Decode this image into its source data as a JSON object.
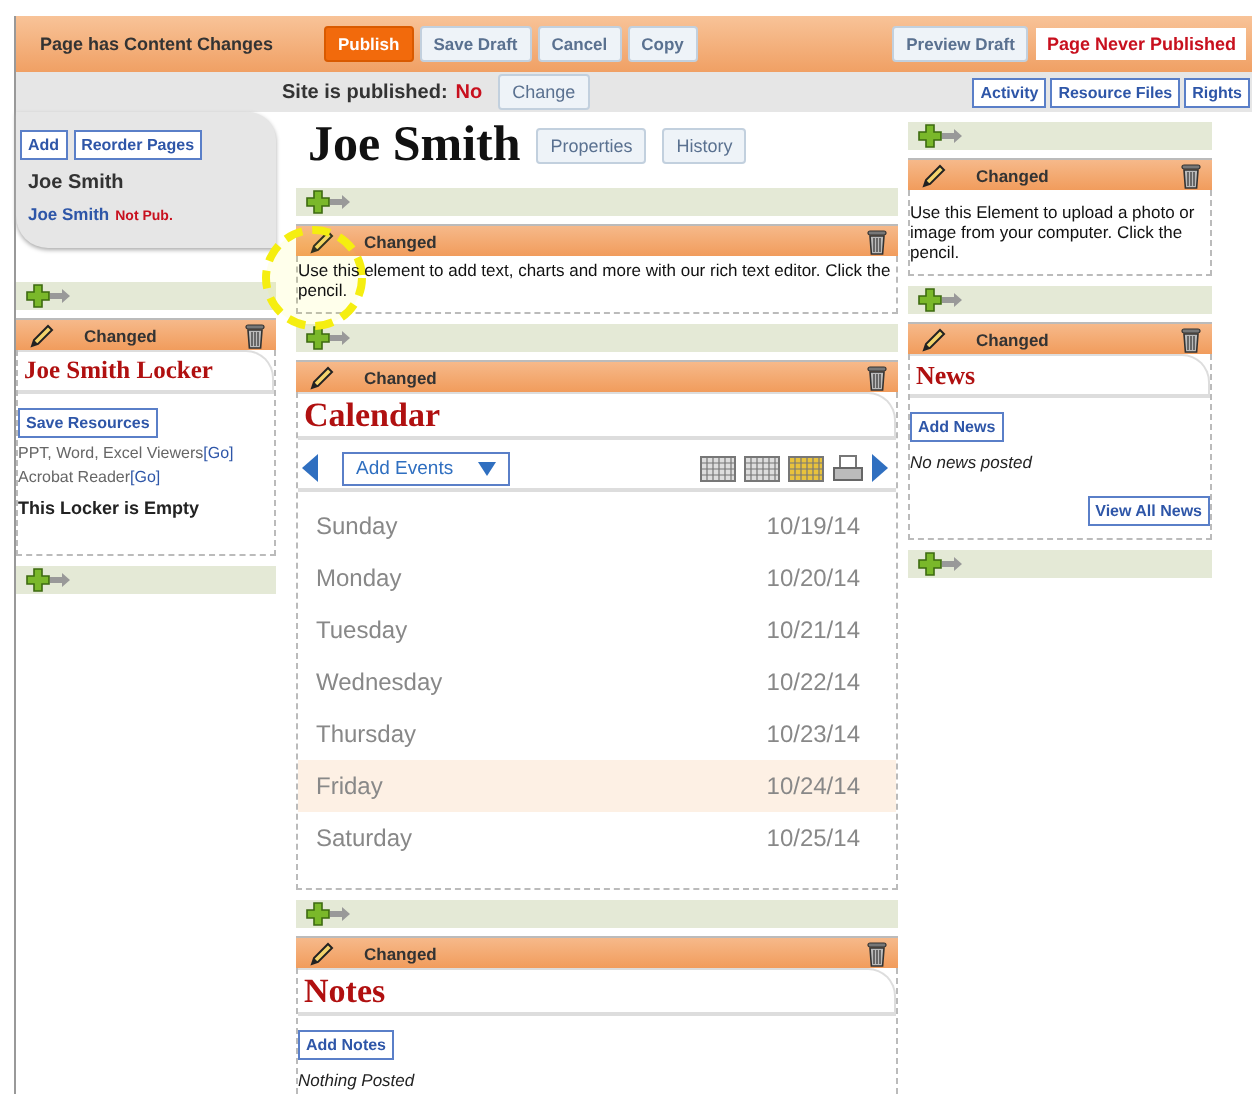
{
  "top_bar": {
    "status": "Page has Content Changes",
    "buttons": [
      {
        "label": "Publish",
        "primary": true
      },
      {
        "label": "Save Draft",
        "primary": false
      },
      {
        "label": "Cancel",
        "primary": false
      },
      {
        "label": "Copy",
        "primary": false
      }
    ],
    "preview_button": "Preview Draft",
    "publish_state": "Page Never Published"
  },
  "sub_bar": {
    "label": "Site is published:",
    "value": "No",
    "change_button": "Change",
    "tabs": [
      "Activity",
      "Resource Files",
      "Rights"
    ]
  },
  "sidebar": {
    "buttons": [
      "Add",
      "Reorder Pages"
    ],
    "heading": "Joe Smith",
    "pages": [
      {
        "name": "Joe Smith",
        "badge": "Not Pub."
      }
    ]
  },
  "page_title": "Joe Smith",
  "title_buttons": [
    "Properties",
    "History"
  ],
  "columns": [
    {
      "elements": [
        {
          "kind": "locker",
          "status": "Changed",
          "title": "Joe Smith Locker",
          "button": "Save Resources",
          "viewers": [
            {
              "text": "PPT, Word, Excel Viewers",
              "link": "[Go]"
            },
            {
              "text": "Acrobat Reader",
              "link": "[Go]"
            }
          ],
          "empty_text": "This Locker is Empty"
        }
      ]
    },
    {
      "elements": [
        {
          "kind": "text",
          "status": "Changed",
          "text": "Use this element to add text, charts and more with our rich text editor. Click the pencil."
        },
        {
          "kind": "calendar",
          "status": "Changed",
          "title": "Calendar",
          "dropdown": "Add Events",
          "days": [
            {
              "day": "Sunday",
              "date": "10/19/14",
              "today": false
            },
            {
              "day": "Monday",
              "date": "10/20/14",
              "today": false
            },
            {
              "day": "Tuesday",
              "date": "10/21/14",
              "today": false
            },
            {
              "day": "Wednesday",
              "date": "10/22/14",
              "today": false
            },
            {
              "day": "Thursday",
              "date": "10/23/14",
              "today": false
            },
            {
              "day": "Friday",
              "date": "10/24/14",
              "today": true
            },
            {
              "day": "Saturday",
              "date": "10/25/14",
              "today": false
            }
          ]
        },
        {
          "kind": "notes",
          "status": "Changed",
          "title": "Notes",
          "button": "Add Notes",
          "empty_text": "Nothing Posted"
        }
      ]
    },
    {
      "elements": [
        {
          "kind": "image",
          "status": "Changed",
          "text": "Use this Element to upload a photo or image from your computer. Click the pencil."
        },
        {
          "kind": "news",
          "status": "Changed",
          "title": "News",
          "button": "Add News",
          "empty_text": "No news posted",
          "link": "View All News"
        }
      ]
    }
  ]
}
